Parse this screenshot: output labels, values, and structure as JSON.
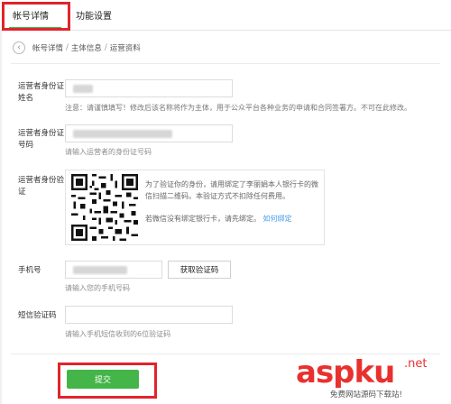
{
  "tabs": [
    {
      "label": "帐号详情",
      "active": true
    },
    {
      "label": "功能设置",
      "active": false
    }
  ],
  "breadcrumb": [
    "帐号详情",
    "主体信息",
    "运营资料"
  ],
  "breadcrumb_separator": "/",
  "form": {
    "name": {
      "label": "运营者身份证姓名",
      "note": "注意：请谨慎填写！修改后该名称将作为主体，用于公众平台各种业务的申请和合同签署方。不可在此修改。"
    },
    "id_number": {
      "label": "运营者身份证号码",
      "hint": "请输入运营者的身份证号码"
    },
    "verify": {
      "label": "运营者身份验证",
      "text": "为了验证你的身份，请用绑定了李丽娟本人银行卡的微信扫描二维码。本验证方式不扣除任何费用。",
      "no_card_text": "若微信没有绑定银行卡，请先绑定。",
      "link": "如何绑定"
    },
    "phone": {
      "label": "手机号",
      "hint": "请输入您的手机号码",
      "get_code_button": "获取验证码"
    },
    "sms": {
      "label": "短信验证码",
      "hint": "请输入手机短信收到的6位验证码"
    }
  },
  "submit_button": "提交",
  "watermark": {
    "main": "aspku",
    "net": ".net",
    "sub": "免费网站源码下载站!"
  },
  "colors": {
    "accent_green": "#44b549",
    "highlight_red": "#e0252b",
    "link_blue": "#459ae9"
  }
}
